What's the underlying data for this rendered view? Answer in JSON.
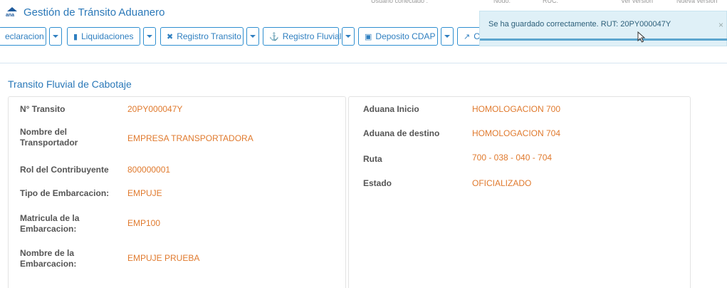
{
  "header": {
    "app_title": "Gestión de Tránsito Aduanero",
    "logo_text": "ana",
    "faint_1": "Usuario conectado :",
    "faint_2": "Nodo:",
    "faint_3": "RUC:",
    "faint_4": "Ver versión",
    "faint_5": "Nueva versión"
  },
  "toolbar": {
    "declaracion": "eclaracion",
    "liquidaciones": "Liquidaciones",
    "registro_transito": "Registro Transito",
    "registro_fluvial": "Registro Fluvial",
    "deposito_cdap": "Deposito CDAP",
    "last_partial": "C"
  },
  "toast": {
    "message": "Se ha guardado correctamente. RUT: 20PY000047Y",
    "close": "×"
  },
  "section": {
    "title": "Transito Fluvial de Cabotaje"
  },
  "left_panel": {
    "nro_transito": {
      "label": "N° Transito",
      "value": "20PY000047Y"
    },
    "transportador": {
      "label1": "Nombre del",
      "label2": "Transportador",
      "value": "EMPRESA TRANSPORTADORA"
    },
    "rol": {
      "label": "Rol del Contribuyente",
      "value": "800000001"
    },
    "tipo": {
      "label": "Tipo de Embarcacion:",
      "value": "EMPUJE"
    },
    "matricula": {
      "label1": "Matricula de la",
      "label2": "Embarcacion:",
      "value": "EMP100"
    },
    "nombre_emb": {
      "label1": "Nombre de la",
      "label2": "Embarcacion:",
      "value": "EMPUJE PRUEBA"
    }
  },
  "right_panel": {
    "aduana_inicio": {
      "label": "Aduana Inicio",
      "value": "HOMOLOGACION 700"
    },
    "aduana_destino": {
      "label": "Aduana de destino",
      "value": "HOMOLOGACION 704"
    },
    "ruta": {
      "label": "Ruta",
      "value": "700 - 038 - 040 - 704"
    },
    "estado": {
      "label": "Estado",
      "value": "OFICIALIZADO"
    }
  },
  "colors": {
    "accent": "#2a78b8",
    "value": "#e07a2e",
    "toast_bg": "#dff0f7"
  }
}
